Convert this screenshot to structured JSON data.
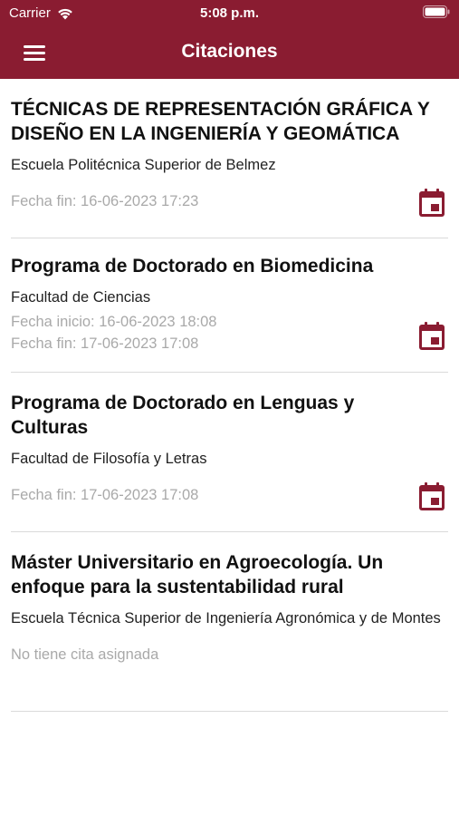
{
  "status_bar": {
    "carrier": "Carrier",
    "time": "5:08 p.m.",
    "wifi_icon": "wifi-icon",
    "battery_icon": "battery-icon"
  },
  "header": {
    "title": "Citaciones",
    "menu_icon": "hamburger-menu-icon",
    "background": "#8a1c31"
  },
  "citations": [
    {
      "title": "TÉCNICAS DE REPRESENTACIÓN GRÁFICA Y DISEÑO EN LA INGENIERÍA Y GEOMÁTICA",
      "center": "Escuela Politécnica Superior de Belmez",
      "date_start": "",
      "date_end": "Fecha fin: 16-06-2023 17:23",
      "has_calendar": true
    },
    {
      "title": "Programa de Doctorado en Biomedicina",
      "center": "Facultad de Ciencias",
      "date_start": "Fecha inicio: 16-06-2023 18:08",
      "date_end": "Fecha fin: 17-06-2023 17:08",
      "has_calendar": true
    },
    {
      "title": "Programa de Doctorado en Lenguas y Culturas",
      "center": "Facultad de Filosofía y Letras",
      "date_start": "",
      "date_end": "Fecha fin: 17-06-2023 17:08",
      "has_calendar": true
    },
    {
      "title": "Máster Universitario en Agroecología. Un enfoque para la sustentabilidad rural",
      "center": "Escuela Técnica Superior de Ingeniería Agronómica y de Montes",
      "date_start": "",
      "date_end": "No tiene cita asignada",
      "has_calendar": false
    }
  ],
  "accent_color": "#8a1c31",
  "calendar_icon": "calendar-icon"
}
